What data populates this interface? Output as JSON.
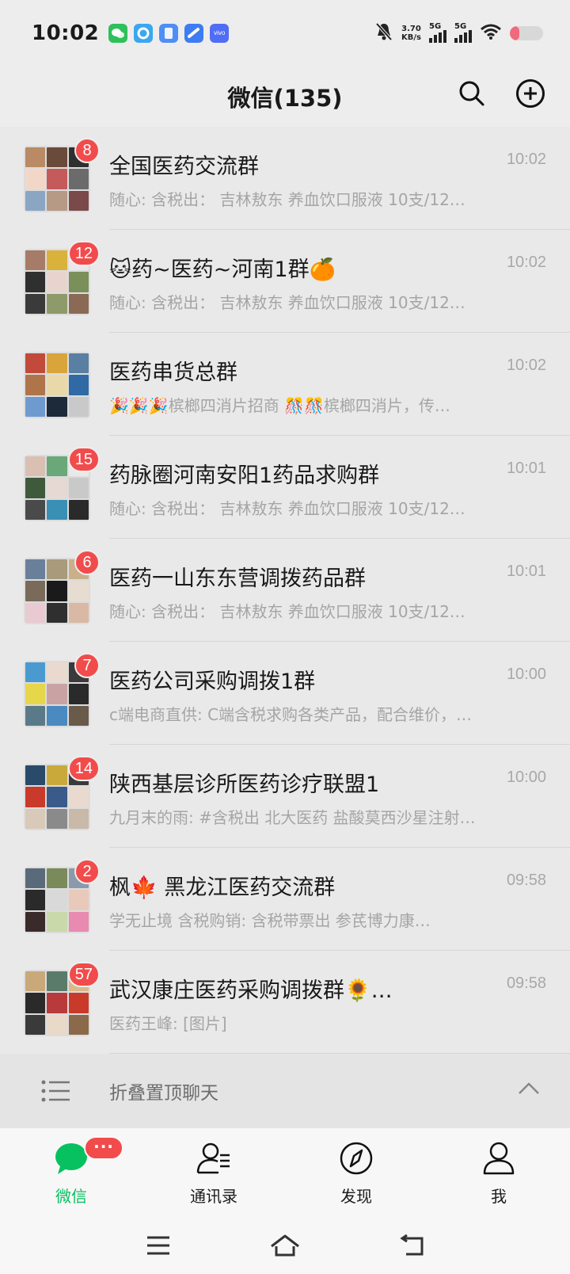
{
  "status_bar": {
    "time": "10:02",
    "speed_value": "3.70",
    "speed_unit": "KB/s",
    "signal1_label": "5G",
    "signal2_label": "5G",
    "battery_level": 0.28,
    "notification_icons": [
      "wechat-icon",
      "app-icon",
      "app-icon",
      "app-icon",
      "vivo-icon"
    ],
    "vivo_text": "vivo"
  },
  "header": {
    "title": "微信(135)",
    "search_icon": "search-icon",
    "add_icon": "add-circle-icon"
  },
  "chats": [
    {
      "name": "全国医药交流群",
      "time": "10:02",
      "badge": "8",
      "preview": "随心: 含税出：   吉林敖东    养血饮口服液    10支/12…",
      "avatar_colors": [
        "#b98a63",
        "#6a4a3a",
        "#2f2f2f",
        "#f2d7c8",
        "#c45a5a",
        "#6b6b6b",
        "#8aa6c2",
        "#b79a85",
        "#7a4a4a"
      ]
    },
    {
      "name": "🐱药~医药~河南1群🍊",
      "time": "10:02",
      "badge": "12",
      "preview": "随心: 含税出：   吉林敖东    养血饮口服液    10支/12…",
      "avatar_colors": [
        "#a67c68",
        "#d9b23b",
        "#e9e9e9",
        "#2f2f2f",
        "#e8d4cf",
        "#7b8f5a",
        "#3a3a3a",
        "#8e9a6a",
        "#8b6a55"
      ]
    },
    {
      "name": "医药串货总群",
      "time": "10:02",
      "badge": "",
      "preview": "🎉🎉🎉槟榔四消片招商    🎊🎊槟榔四消片，传…",
      "avatar_colors": [
        "#c24a3a",
        "#d9a53b",
        "#5a7fa3",
        "#b0744b",
        "#e9d9a8",
        "#2f6aa5",
        "#6f9ad0",
        "#1d2a3a",
        "#c9c9c9"
      ]
    },
    {
      "name": "药脉圈河南安阳1药品求购群",
      "time": "10:01",
      "badge": "15",
      "preview": "随心: 含税出：   吉林敖东    养血饮口服液    10支/12…",
      "avatar_colors": [
        "#d9c0b3",
        "#6aa87a",
        "#e9e9e9",
        "#3f5a3a",
        "#e6d8d2",
        "#c9c9c9",
        "#4a4a4a",
        "#3a8fb5",
        "#2a2a2a"
      ]
    },
    {
      "name": "医药一山东东营调拨药品群",
      "time": "10:01",
      "badge": "6",
      "preview": "随心: 含税出：   吉林敖东    养血饮口服液    10支/12…",
      "avatar_colors": [
        "#6a7f9a",
        "#a89a7a",
        "#c9b08a",
        "#7a6a5a",
        "#1a1a1a",
        "#e6dccf",
        "#e9c9d2",
        "#2f2f2f",
        "#d9b9a3"
      ]
    },
    {
      "name": "医药公司采购调拨1群",
      "time": "10:00",
      "badge": "7",
      "preview": "c端电商直供: C端含税求购各类产品，配合维价，…",
      "avatar_colors": [
        "#4a9ad0",
        "#e9d9cf",
        "#3a3a3a",
        "#e6d64a",
        "#c9a3a3",
        "#2a2a2a",
        "#5a7a8a",
        "#4a8ac0",
        "#6a5a4a"
      ]
    },
    {
      "name": "陕西基层诊所医药诊疗联盟1",
      "time": "10:00",
      "badge": "14",
      "preview": "九月末的雨: #含税出 北大医药 盐酸莫西沙星注射…",
      "avatar_colors": [
        "#2a4a6a",
        "#c9a93a",
        "#3a3a3a",
        "#c93a2a",
        "#3a5a8a",
        "#e9d9cf",
        "#d9c9b9",
        "#8a8a8a",
        "#c9b9a9"
      ]
    },
    {
      "name": "枫🍁 黑龙江医药交流群",
      "time": "09:58",
      "badge": "2",
      "preview": "学无止境 含税购销:            含税带票出 参芪博力康…",
      "avatar_colors": [
        "#5a6a7a",
        "#7a8a5a",
        "#8a9aaa",
        "#2a2a2a",
        "#d9d9d9",
        "#e9c9b9",
        "#3a2a2a",
        "#c9d9a9",
        "#e98ab0"
      ]
    },
    {
      "name": "武汉康庄医药采购调拨群🌻…",
      "time": "09:58",
      "badge": "57",
      "preview": "医药王峰: [图片]",
      "avatar_colors": [
        "#c9a97a",
        "#5a7a6a",
        "#d9b98a",
        "#2a2a2a",
        "#b93a3a",
        "#c93a2a",
        "#3a3a3a",
        "#e9d9c9",
        "#8a6a4a"
      ]
    }
  ],
  "fold_row": {
    "label": "折叠置顶聊天",
    "icon": "list-icon",
    "chevron": "chevron-up-icon"
  },
  "tabs": [
    {
      "label": "微信",
      "icon": "chat-bubble-icon",
      "active": true,
      "badge": "···"
    },
    {
      "label": "通讯录",
      "icon": "contacts-icon",
      "active": false
    },
    {
      "label": "发现",
      "icon": "compass-icon",
      "active": false
    },
    {
      "label": "我",
      "icon": "person-icon",
      "active": false
    }
  ],
  "nav": {
    "menu_icon": "menu-icon",
    "home_icon": "home-icon",
    "back_icon": "back-icon"
  },
  "colors": {
    "accent": "#07c160",
    "badge": "#f24b4b",
    "background": "#ededed"
  }
}
